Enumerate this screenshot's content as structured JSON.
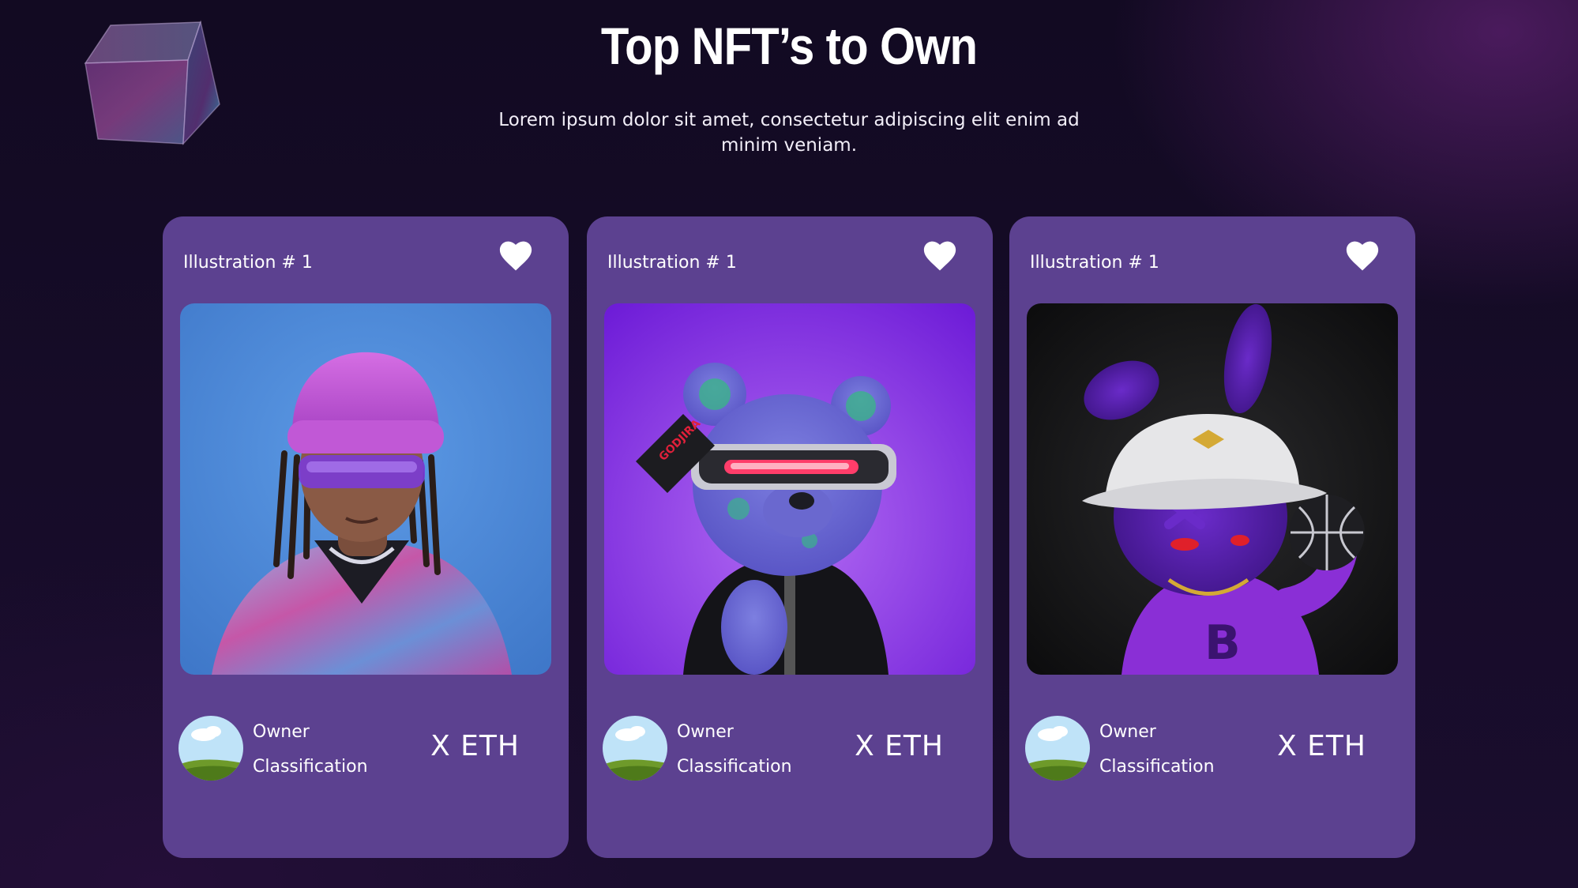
{
  "header": {
    "title": "Top NFT’s to Own",
    "subtitle": "Lorem ipsum dolor sit amet, consectetur adipiscing elit enim ad minim veniam."
  },
  "decor": {
    "icon": "glass-cube-icon"
  },
  "cards": [
    {
      "title": "Illustration # 1",
      "favorite_icon": "heart-icon",
      "image": "nft-avatar-girl-pink-beanie",
      "owner_label": "Owner",
      "classification_label": "Classification",
      "price": "X ETH"
    },
    {
      "title": "Illustration # 1",
      "favorite_icon": "heart-icon",
      "image": "nft-bear-cyber-visor",
      "owner_label": "Owner",
      "classification_label": "Classification",
      "price": "X ETH"
    },
    {
      "title": "Illustration # 1",
      "favorite_icon": "heart-icon",
      "image": "nft-bunny-bucket-hat",
      "owner_label": "Owner",
      "classification_label": "Classification",
      "price": "X ETH"
    }
  ],
  "colors": {
    "background": "#150b26",
    "card": "#5c4190",
    "text": "#ffffff"
  }
}
